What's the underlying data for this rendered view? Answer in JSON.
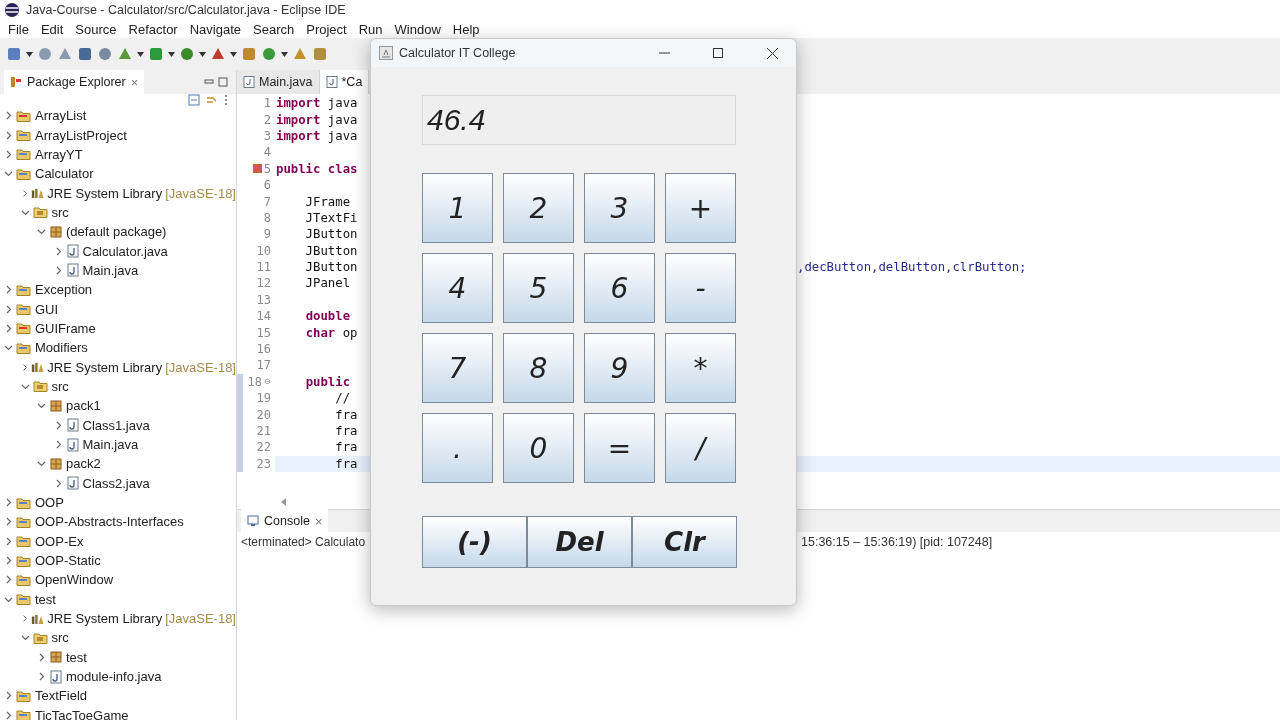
{
  "window": {
    "title": "Java-Course - Calculator/src/Calculator.java - Eclipse IDE"
  },
  "menu": [
    "File",
    "Edit",
    "Source",
    "Refactor",
    "Navigate",
    "Search",
    "Project",
    "Run",
    "Window",
    "Help"
  ],
  "package_explorer": {
    "title": "Package Explorer",
    "close": "×",
    "tree": [
      {
        "label": "ArrayList",
        "kind": "project-error",
        "expanded": false
      },
      {
        "label": "ArrayListProject",
        "kind": "project",
        "expanded": false
      },
      {
        "label": "ArrayYT",
        "kind": "project",
        "expanded": false
      },
      {
        "label": "Calculator",
        "kind": "project",
        "expanded": true,
        "children": [
          {
            "label": "JRE System Library",
            "suffix": "[JavaSE-18]",
            "kind": "library",
            "expanded": false
          },
          {
            "label": "src",
            "kind": "src",
            "expanded": true,
            "children": [
              {
                "label": "(default package)",
                "kind": "package",
                "expanded": true,
                "children": [
                  {
                    "label": "Calculator.java",
                    "kind": "java",
                    "expanded": false
                  },
                  {
                    "label": "Main.java",
                    "kind": "java",
                    "expanded": false
                  }
                ]
              }
            ]
          }
        ]
      },
      {
        "label": "Exception",
        "kind": "project",
        "expanded": false
      },
      {
        "label": "GUI",
        "kind": "project",
        "expanded": false
      },
      {
        "label": "GUIFrame",
        "kind": "project-error",
        "expanded": false
      },
      {
        "label": "Modifiers",
        "kind": "project",
        "expanded": true,
        "children": [
          {
            "label": "JRE System Library",
            "suffix": "[JavaSE-18]",
            "kind": "library",
            "expanded": false
          },
          {
            "label": "src",
            "kind": "src",
            "expanded": true,
            "children": [
              {
                "label": "pack1",
                "kind": "package",
                "expanded": true,
                "children": [
                  {
                    "label": "Class1.java",
                    "kind": "java",
                    "expanded": false
                  },
                  {
                    "label": "Main.java",
                    "kind": "java",
                    "expanded": false
                  }
                ]
              },
              {
                "label": "pack2",
                "kind": "package",
                "expanded": true,
                "children": [
                  {
                    "label": "Class2.java",
                    "kind": "java",
                    "expanded": false
                  }
                ]
              }
            ]
          }
        ]
      },
      {
        "label": "OOP",
        "kind": "project",
        "expanded": false
      },
      {
        "label": "OOP-Abstracts-Interfaces",
        "kind": "project",
        "expanded": false
      },
      {
        "label": "OOP-Ex",
        "kind": "project",
        "expanded": false
      },
      {
        "label": "OOP-Static",
        "kind": "project",
        "expanded": false
      },
      {
        "label": "OpenWindow",
        "kind": "project",
        "expanded": false
      },
      {
        "label": "test",
        "kind": "project",
        "expanded": true,
        "children": [
          {
            "label": "JRE System Library",
            "suffix": "[JavaSE-18]",
            "kind": "library",
            "expanded": false
          },
          {
            "label": "src",
            "kind": "src",
            "expanded": true,
            "children": [
              {
                "label": "test",
                "kind": "package",
                "expanded": false
              },
              {
                "label": "module-info.java",
                "kind": "java",
                "expanded": false
              }
            ]
          }
        ]
      },
      {
        "label": "TextField",
        "kind": "project",
        "expanded": false
      },
      {
        "label": "TicTacToeGame",
        "kind": "project",
        "expanded": false
      }
    ]
  },
  "editor": {
    "tabs": [
      {
        "label": "Main.java",
        "selected": false
      },
      {
        "label": "*Ca",
        "selected": true
      }
    ],
    "lines": [
      {
        "number": "1",
        "code": "**import** java"
      },
      {
        "number": "2",
        "code": "**import** java"
      },
      {
        "number": "3",
        "code": "**import** java"
      },
      {
        "number": "4"
      },
      {
        "number": "5",
        "code": "**public** **clas**",
        "marker": true
      },
      {
        "number": "6"
      },
      {
        "number": "7",
        "code": "    JFrame"
      },
      {
        "number": "8",
        "code": "    JTextFi"
      },
      {
        "number": "9",
        "code": "    JButton"
      },
      {
        "number": "10",
        "code": "    JButton"
      },
      {
        "number": "11",
        "code": "    JButton",
        "tail": ",decButton,delButton,clrButton;"
      },
      {
        "number": "12",
        "code": "    JPanel"
      },
      {
        "number": "13"
      },
      {
        "number": "14",
        "code": "    **double**"
      },
      {
        "number": "15",
        "code": "    **char** op"
      },
      {
        "number": "16"
      },
      {
        "number": "17"
      },
      {
        "number": "18",
        "code": "    **public**",
        "fold": "⊖"
      },
      {
        "number": "19",
        "code": "        //"
      },
      {
        "number": "20",
        "code": "        fra"
      },
      {
        "number": "21",
        "code": "        fra"
      },
      {
        "number": "22",
        "code": "        fra"
      },
      {
        "number": "23",
        "code": "        fra",
        "current": true
      }
    ]
  },
  "console": {
    "title": "Console",
    "close": "×",
    "text": "<terminated> Calculato",
    "tail": "15:36:15 – 15:36:19) [pid: 107248]"
  },
  "calculator": {
    "title": "Calculator IT College",
    "display": "46.4",
    "keys": [
      "1",
      "2",
      "3",
      "+",
      "4",
      "5",
      "6",
      "-",
      "7",
      "8",
      "9",
      "*",
      ".",
      "0",
      "=",
      "/"
    ],
    "bottom_keys": [
      "(-)",
      "Del",
      "Clr"
    ]
  }
}
